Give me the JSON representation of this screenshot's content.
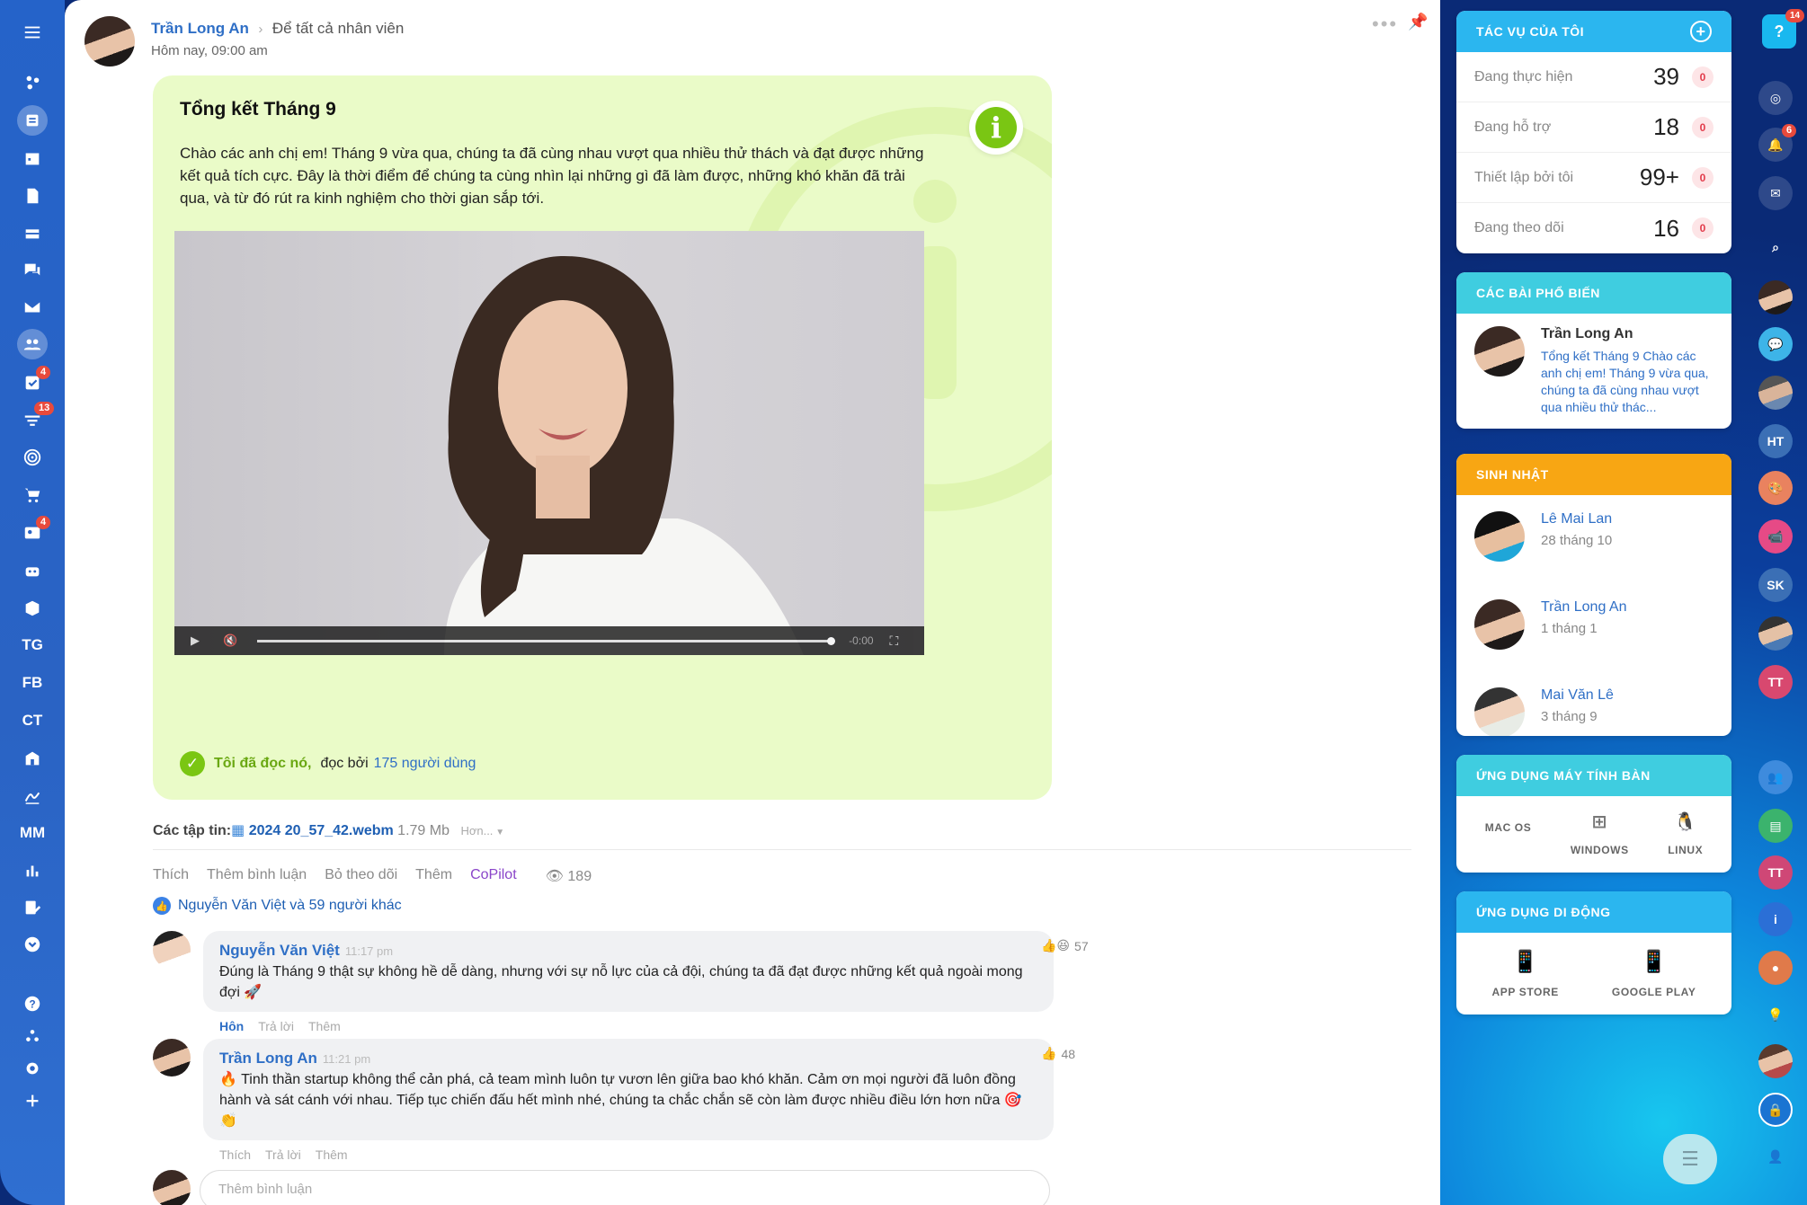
{
  "sidebar": {
    "items": [
      {
        "icon": "menu-icon"
      },
      {
        "icon": "network-icon"
      },
      {
        "icon": "newsfeed-icon"
      },
      {
        "icon": "calendar-icon"
      },
      {
        "icon": "document-icon"
      },
      {
        "icon": "inbox-icon"
      },
      {
        "icon": "chat-icon"
      },
      {
        "icon": "mail-icon"
      },
      {
        "icon": "group-icon"
      },
      {
        "icon": "task-check-icon",
        "badge": "4"
      },
      {
        "icon": "filter-icon",
        "badge": "13"
      },
      {
        "icon": "target-icon"
      },
      {
        "icon": "cart-icon"
      },
      {
        "icon": "contact-card-icon",
        "badge": "4"
      },
      {
        "icon": "robot-icon"
      },
      {
        "icon": "box-icon"
      },
      {
        "text": "TG"
      },
      {
        "text": "FB"
      },
      {
        "text": "CT"
      },
      {
        "icon": "building-icon"
      },
      {
        "icon": "signature-icon"
      },
      {
        "text": "MM"
      },
      {
        "icon": "chart-icon"
      },
      {
        "icon": "edit-list-icon"
      },
      {
        "icon": "chevron-circle-icon"
      },
      {
        "icon": "help-icon"
      },
      {
        "icon": "share-icon"
      },
      {
        "icon": "settings-icon"
      },
      {
        "icon": "plus-icon"
      }
    ]
  },
  "post": {
    "author": "Trần Long An",
    "target": "Để tất cả nhân viên",
    "time": "Hôm nay, 09:00 am",
    "title": "Tổng kết Tháng 9",
    "body": "Chào các anh chị em! Tháng 9 vừa qua, chúng ta đã cùng nhau vượt qua nhiều thử thách và đạt được những kết quả tích cực. Đây là thời điểm để chúng ta cùng nhìn lại những gì đã làm được, những khó khăn đã trải qua, và từ đó rút ra kinh nghiệm cho thời gian sắp tới.",
    "video_time": "-0:00",
    "read_label": "Tôi đã đọc nó,",
    "read_by": "đọc bởi",
    "read_users": "175 người dùng",
    "files_label": "Các tập tin:",
    "file_name": "2024 20_57_42.webm",
    "file_size": "1.79 Mb",
    "file_more": "Hơn...",
    "actions": [
      "Thích",
      "Thêm bình luận",
      "Bỏ theo dõi",
      "Thêm",
      "CoPilot"
    ],
    "views": "189",
    "likers": "Nguyễn Văn Việt và 59 người khác"
  },
  "comments": [
    {
      "author": "Nguyễn Văn Việt",
      "time": "11:17 pm",
      "text": "Đúng là Tháng 9 thật sự không hề dễ dàng, nhưng với sự nỗ lực của cả đội, chúng ta đã đạt được những kết quả ngoài mong đợi 🚀",
      "actions": [
        "Hôn",
        "Trả lời",
        "Thêm"
      ],
      "reactions": "57"
    },
    {
      "author": "Trần Long An",
      "time": "11:21 pm",
      "text": "🔥 Tinh thần startup không thể cản phá, cả team mình luôn tự vươn lên giữa bao khó khăn. Cảm ơn mọi người đã luôn đồng hành và sát cánh với nhau. Tiếp tục chiến đấu hết mình nhé, chúng ta chắc chắn sẽ còn làm được nhiều điều lớn hơn nữa 🎯 👏",
      "actions": [
        "Thích",
        "Trả lời",
        "Thêm"
      ],
      "reactions": "48"
    }
  ],
  "add_comment_placeholder": "Thêm bình luận",
  "tasks": {
    "title": "TÁC VỤ CỦA TÔI",
    "rows": [
      {
        "label": "Đang thực hiện",
        "count": "39",
        "alert": "0"
      },
      {
        "label": "Đang hỗ trợ",
        "count": "18",
        "alert": "0"
      },
      {
        "label": "Thiết lập bởi tôi",
        "count": "99+",
        "alert": "0"
      },
      {
        "label": "Đang theo dõi",
        "count": "16",
        "alert": "0"
      }
    ]
  },
  "popular": {
    "title": "CÁC BÀI PHỔ BIẾN",
    "author": "Trần Long An",
    "excerpt": "Tổng kết Tháng 9 Chào các anh chị em! Tháng 9 vừa qua, chúng ta đã cùng nhau vượt qua nhiều thử thác..."
  },
  "birthdays": {
    "title": "SINH NHẬT",
    "people": [
      {
        "name": "Lê Mai Lan",
        "date": "28 tháng 10"
      },
      {
        "name": "Trần Long An",
        "date": "1 tháng 1"
      },
      {
        "name": "Mai Văn Lê",
        "date": "3 tháng 9"
      }
    ]
  },
  "desktop_apps": {
    "title": "ỨNG DỤNG MÁY TÍNH BÀN",
    "items": [
      "MAC OS",
      "WINDOWS",
      "LINUX"
    ]
  },
  "mobile_apps": {
    "title": "ỨNG DỤNG DI ĐỘNG",
    "items": [
      "APP STORE",
      "GOOGLE PLAY"
    ]
  },
  "rail": {
    "help_badge": "14",
    "notif_badge": "6",
    "initials": [
      "HT",
      "SK",
      "TT",
      "TT"
    ]
  },
  "colors": {
    "accent_blue": "#2f6fc6",
    "panel_blue": "#2bb6ef",
    "panel_teal": "#3fcde0",
    "panel_orange": "#f8a613",
    "green": "#7ac613"
  }
}
